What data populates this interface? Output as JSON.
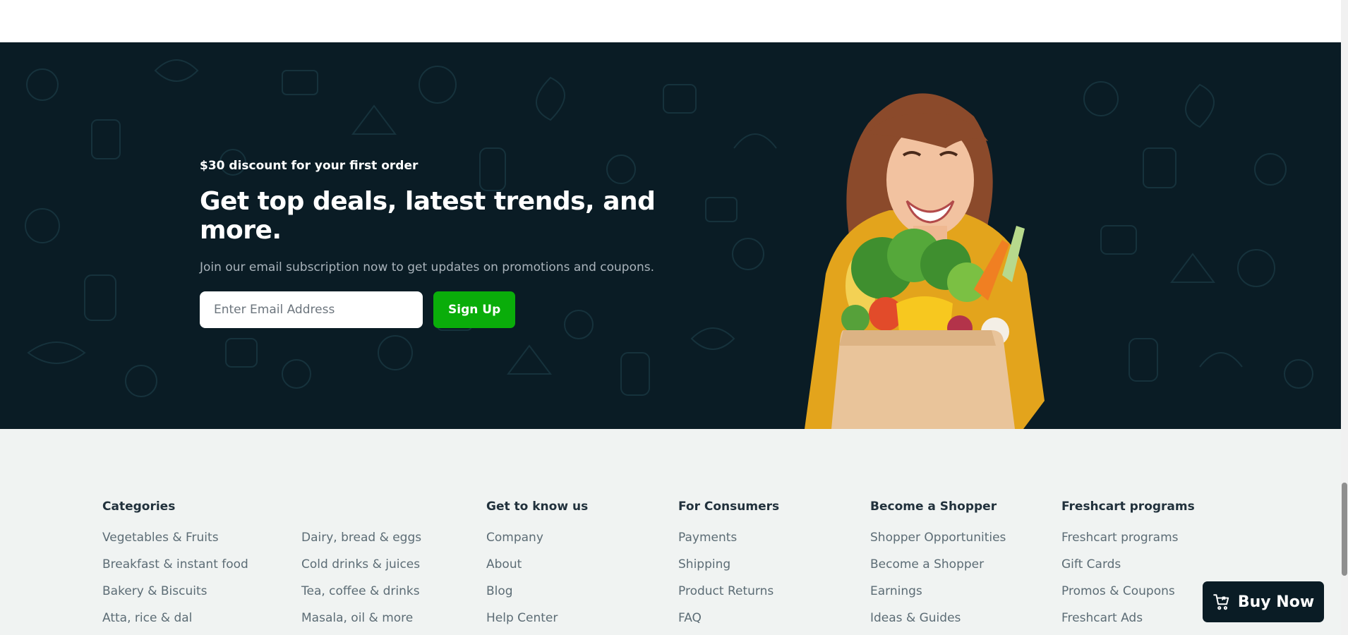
{
  "banner": {
    "kicker": "$30 discount for your first order",
    "title": "Get top deals, latest trends, and more.",
    "subtitle": "Join our email subscription now to get updates on promotions and coupons.",
    "email_placeholder": "Enter Email Address",
    "signup_label": "Sign Up",
    "image_icon": "woman-with-grocery-bag-illustration"
  },
  "footer": {
    "categories": {
      "title": "Categories",
      "col1": [
        "Vegetables & Fruits",
        "Breakfast & instant food",
        "Bakery & Biscuits",
        "Atta, rice & dal"
      ],
      "col2": [
        "Dairy, bread & eggs",
        "Cold drinks & juices",
        "Tea, coffee & drinks",
        "Masala, oil & more"
      ]
    },
    "know_us": {
      "title": "Get to know us",
      "items": [
        "Company",
        "About",
        "Blog",
        "Help Center"
      ]
    },
    "consumers": {
      "title": "For Consumers",
      "items": [
        "Payments",
        "Shipping",
        "Product Returns",
        "FAQ"
      ]
    },
    "shopper": {
      "title": "Become a Shopper",
      "items": [
        "Shopper Opportunities",
        "Become a Shopper",
        "Earnings",
        "Ideas & Guides"
      ]
    },
    "programs": {
      "title": "Freshcart programs",
      "items": [
        "Freshcart programs",
        "Gift Cards",
        "Promos & Coupons",
        "Freshcart Ads"
      ]
    }
  },
  "buy_now": {
    "label": "Buy Now",
    "icon": "cart-icon"
  },
  "colors": {
    "banner_bg": "#0a1c25",
    "accent_green": "#0aad0a",
    "footer_bg": "#f0f3f2",
    "heading": "#21313c",
    "link": "#5c6c75"
  }
}
